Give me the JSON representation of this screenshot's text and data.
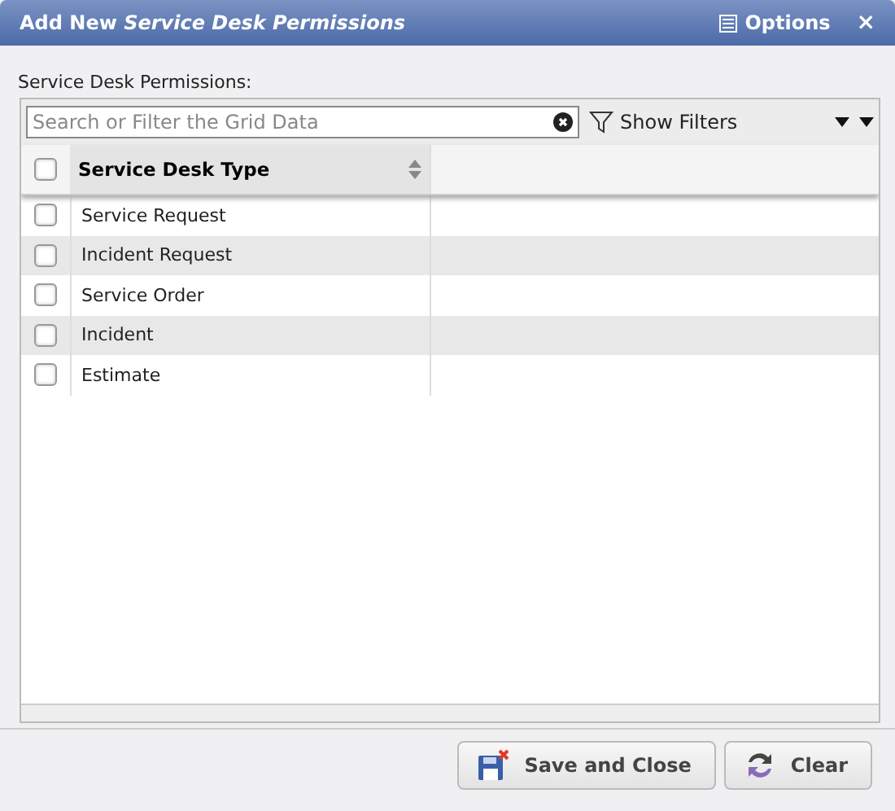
{
  "window": {
    "title": "Add New *Service Desk Permissions*",
    "options_label": "Options",
    "close": "×"
  },
  "section_label": "Service Desk Permissions:",
  "search": {
    "placeholder": "Search or Filter the Grid Data"
  },
  "show_filters": "Show Filters",
  "table": {
    "header_checked": false,
    "columns": [
      "Service Desk Type"
    ],
    "rows": [
      {
        "type": "Service Request",
        "checked": false
      },
      {
        "type": "Incident Request",
        "checked": false
      },
      {
        "type": "Service Order",
        "checked": false
      },
      {
        "type": "Incident",
        "checked": false
      },
      {
        "type": "Estimate",
        "checked": false
      }
    ]
  },
  "buttons": [
    {
      "label": "Save and Close",
      "kind": "save"
    },
    {
      "label": "Clear",
      "kind": "clear"
    }
  ]
}
